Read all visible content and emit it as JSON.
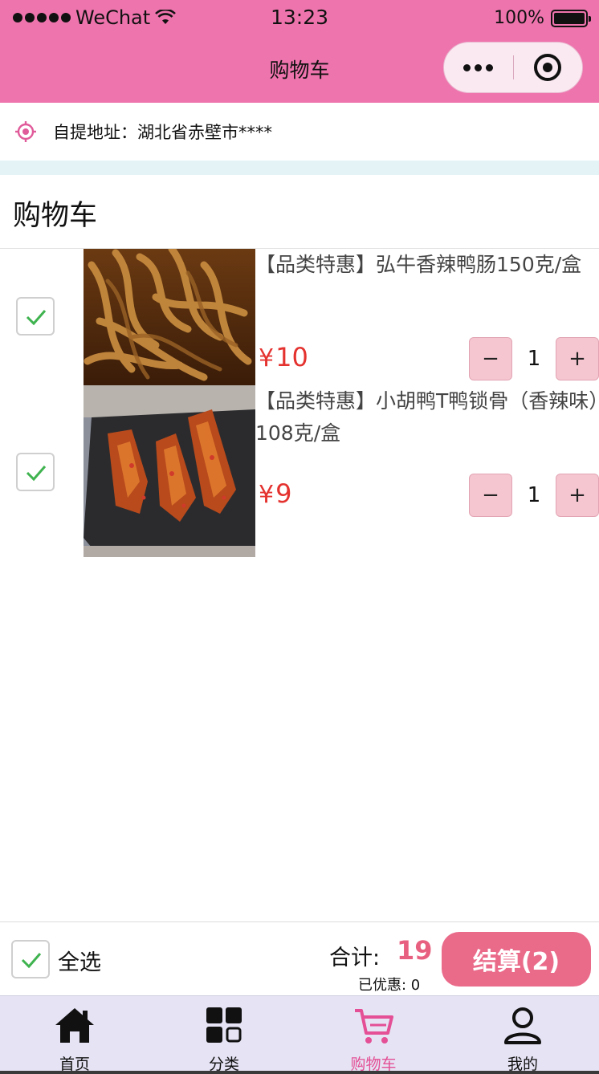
{
  "status_bar": {
    "carrier": "WeChat",
    "time": "13:23",
    "battery": "100%"
  },
  "nav": {
    "title": "购物车"
  },
  "address": {
    "text": "自提地址：湖北省赤壁市****"
  },
  "cart": {
    "title": "购物车",
    "currency": "¥",
    "items": [
      {
        "name": "【品类特惠】弘牛香辣鸭肠150克/盒",
        "price": "10",
        "quantity": "1",
        "checked": true
      },
      {
        "name": "【品类特惠】小胡鸭T鸭锁骨（香辣味）108克/盒",
        "price": "9",
        "quantity": "1",
        "checked": true
      }
    ],
    "stepper": {
      "minus": "−",
      "plus": "+"
    }
  },
  "checkout": {
    "select_all": "全选",
    "total_label": "合计:",
    "total_value": "19",
    "discount": "已优惠: 0",
    "settle": "结算(2)"
  },
  "tabbar": {
    "items": [
      {
        "label": "首页",
        "icon": "home-icon"
      },
      {
        "label": "分类",
        "icon": "grid-icon"
      },
      {
        "label": "购物车",
        "icon": "cart-icon",
        "active": true
      },
      {
        "label": "我的",
        "icon": "user-icon"
      }
    ]
  },
  "colors": {
    "brand": "#ee74ad",
    "price": "#e4322f",
    "accent": "#ea6a8a",
    "check": "#3fb34f"
  }
}
